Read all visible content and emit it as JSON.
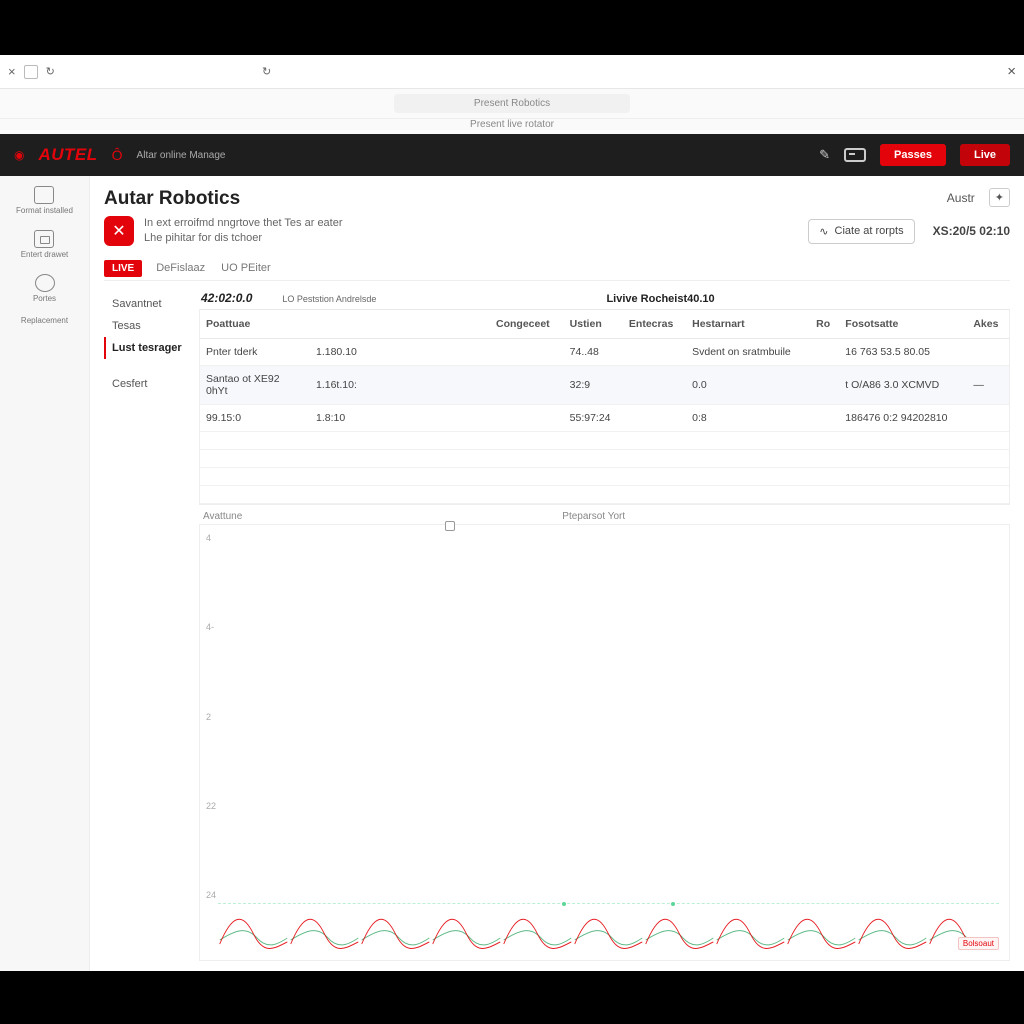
{
  "browser": {
    "close": "×",
    "refresh": "↻",
    "right_close": "×",
    "url_label": "Present Robotics",
    "url_sub": "Present live rotator"
  },
  "header": {
    "logo": "AUTEL",
    "flame": "Ô",
    "sub": "Altar online Manage",
    "btn_pass": "Passes",
    "btn_live": "Live"
  },
  "rail": {
    "items": [
      {
        "label": "Format installed",
        "icon": "cam"
      },
      {
        "label": "Entert drawet",
        "icon": "rob"
      },
      {
        "label": "Portes",
        "icon": "gear"
      },
      {
        "label": "Replacement",
        "icon": ""
      }
    ]
  },
  "page": {
    "title": "Autar Robotics",
    "desc_line1": "In ext erroifmd nngrtove thet Tes ar eater",
    "desc_line2": "Lhe pihitar for dis tchoer",
    "right_label": "Austr",
    "create_btn": "Ciate at rorpts",
    "timestamp": "XS:20/5 02:10"
  },
  "tabs": {
    "live_badge": "LIVE",
    "items": [
      "DeFislaaz",
      "UO PEiter"
    ]
  },
  "sidemenu": {
    "items": [
      "Savantnet",
      "Tesas",
      "Lust tesrager",
      "Cesfert"
    ],
    "active_index": 2
  },
  "panel": {
    "tstamp": "42:02:0.0",
    "tslabel": "LO Peststion Andrelsde",
    "section_label": "Livive Rocheist40.10",
    "columns": [
      "Poattuae",
      "",
      "Congeceet",
      "Ustien",
      "Entecras",
      "Hestarnart",
      "Ro",
      "Fosotsatte",
      "Akes"
    ],
    "rows": [
      {
        "c0": "Pnter tderk",
        "c1": "1.180.10",
        "c2": "",
        "c3": "74..48",
        "c4": "",
        "c5": "Svdent on sratmbuile",
        "c6": "",
        "c7": "16 763 53.5 80.05",
        "c8": ""
      },
      {
        "c0": "Santao ot XE92 0hYt",
        "c1": "1.16t.10:",
        "c2": "",
        "c3": "32:9",
        "c4": "",
        "c5": "0.0",
        "c6": "",
        "c7": "t O/A86 3.0 XCMVD",
        "c8": "—"
      },
      {
        "c0": "99.15:0",
        "c1": "1.8:10",
        "c2": "",
        "c3": "55:97:24",
        "c4": "",
        "c5": "0:8",
        "c6": "",
        "c7": "186476 0:2 94202810",
        "c8": ""
      }
    ],
    "axis_label_left": "Avattune",
    "axis_label_right": "Pteparsot Yort",
    "spark_badge": "Bolsoaut"
  },
  "chart_data": {
    "type": "line",
    "title": "",
    "xlabel": "",
    "ylabel": "",
    "ylim": [
      0,
      100
    ],
    "yticks": [
      "4",
      "4-",
      "2",
      "22",
      "24"
    ],
    "series": [
      {
        "name": "red",
        "color": "#e3040b"
      },
      {
        "name": "green",
        "color": "#4db37a"
      }
    ],
    "spark_pattern_repeats": 11
  }
}
